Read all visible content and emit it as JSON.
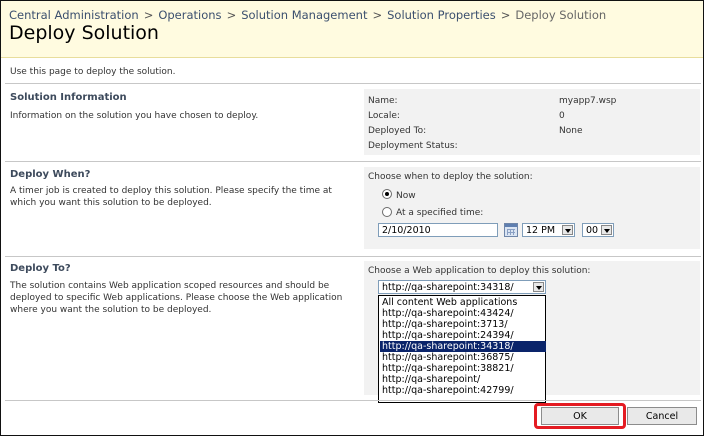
{
  "breadcrumb": {
    "items": [
      "Central Administration",
      "Operations",
      "Solution Management",
      "Solution Properties"
    ],
    "current": "Deploy Solution",
    "separator": ">"
  },
  "page_title": "Deploy Solution",
  "intro": "Use this page to deploy the solution.",
  "solution_info": {
    "title": "Solution Information",
    "description": "Information on the solution you have chosen to deploy.",
    "fields": [
      {
        "label": "Name:",
        "value": "myapp7.wsp"
      },
      {
        "label": "Locale:",
        "value": "0"
      },
      {
        "label": "Deployed To:",
        "value": "None"
      },
      {
        "label": "Deployment Status:",
        "value": ""
      }
    ]
  },
  "deploy_when": {
    "title": "Deploy When?",
    "description_line1": "A timer job is created to deploy this solution. Please specify the time at",
    "description_line2": "which you want this solution to be deployed.",
    "prompt": "Choose when to deploy the solution:",
    "option_now": "Now",
    "option_specified": "At a specified time:",
    "selected": "now",
    "date_value": "2/10/2010",
    "hour_value": "12 PM",
    "minute_value": "00"
  },
  "deploy_to": {
    "title": "Deploy To?",
    "description_line1": "The solution contains Web application scoped resources and should be",
    "description_line2": "deployed to specific Web applications. Please choose the Web application",
    "description_line3": "where you want the solution to be deployed.",
    "prompt": "Choose a Web application to deploy this solution:",
    "selected_value": "http://qa-sharepoint:34318/",
    "options": [
      "All content Web applications",
      "http://qa-sharepoint:43424/",
      "http://qa-sharepoint:3713/",
      "http://qa-sharepoint:24394/",
      "http://qa-sharepoint:34318/",
      "http://qa-sharepoint:36875/",
      "http://qa-sharepoint:38821/",
      "http://qa-sharepoint/",
      "http://qa-sharepoint:42799/"
    ],
    "highlighted_index": 4
  },
  "buttons": {
    "ok": "OK",
    "cancel": "Cancel"
  },
  "colors": {
    "header_bg": "#fffbe0",
    "section_title": "#3d4a5c",
    "highlight": "#e41b22",
    "selected_option": "#0a246a"
  }
}
